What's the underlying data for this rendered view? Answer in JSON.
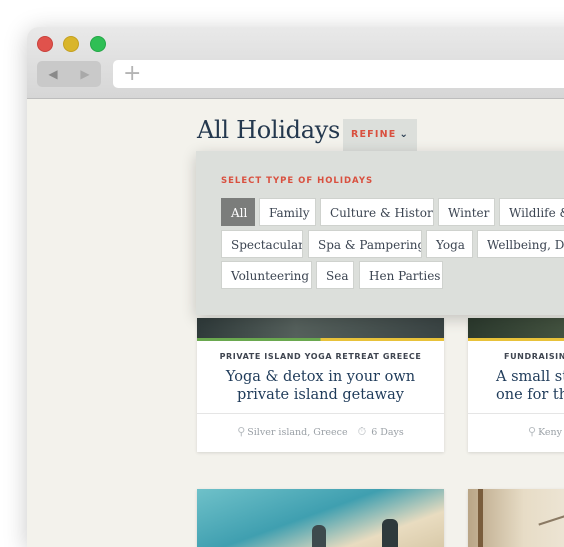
{
  "browser": {
    "nav": {
      "back_icon": "◀",
      "forward_icon": "▶"
    },
    "new_tab_icon": "+"
  },
  "page": {
    "title": "All Holidays",
    "refine_label": "REFINE",
    "refine_chevron": "⌄"
  },
  "refine_panel": {
    "heading": "SELECT TYPE OF HOLIDAYS",
    "selected": "All",
    "options": [
      "All",
      "Family",
      "Culture & History",
      "Winter",
      "Wildlife &",
      "Spectacular",
      "Spa & Pampering",
      "Yoga",
      "Wellbeing, Det",
      "Volunteering",
      "Sea",
      "Hen Parties"
    ]
  },
  "cards": [
    {
      "kicker": "PRIVATE ISLAND YOGA RETREAT GREECE",
      "title": "Yoga & detox in your own private island getaway",
      "location": "Silver island, Greece",
      "duration": "6 Days"
    },
    {
      "kicker": "FUNDRAISING",
      "title": "A small st one for the",
      "location": "Keny"
    }
  ],
  "colors": {
    "accent": "#d9503f",
    "title": "#24384e",
    "stripe_green": "#6aa84f",
    "stripe_yellow": "#e8c23a"
  }
}
